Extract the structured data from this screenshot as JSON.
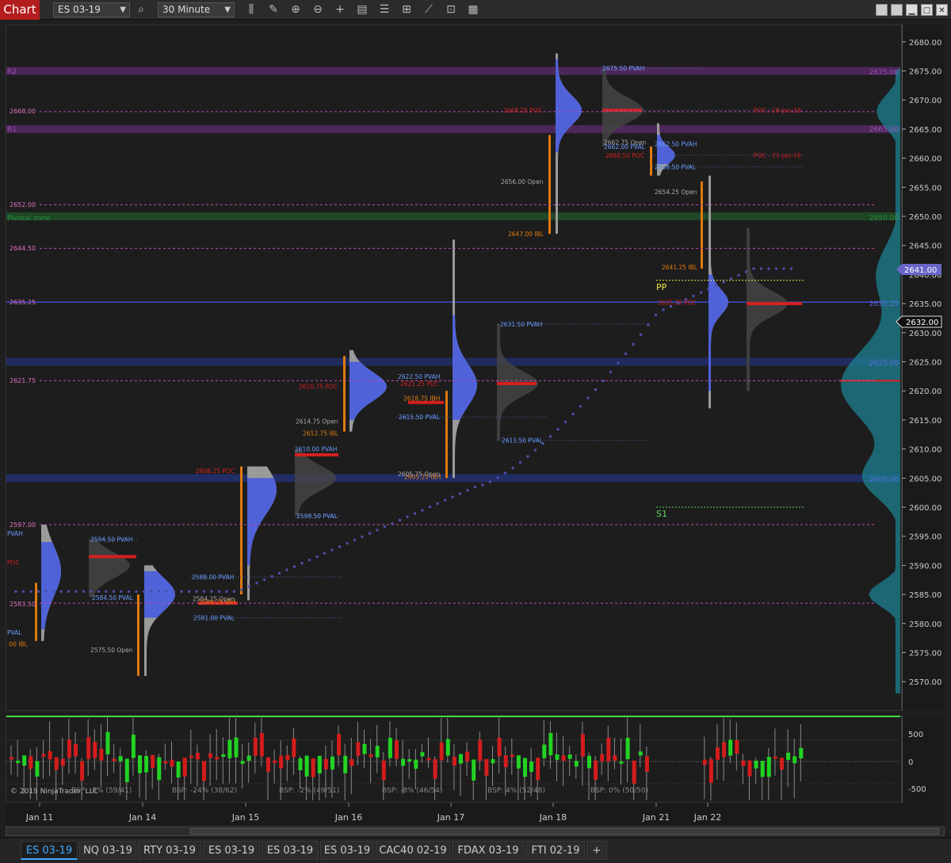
{
  "toolbar": {
    "title": "Chart",
    "instrument": "ES 03-19",
    "interval": "30 Minute",
    "icons": [
      "search-icon",
      "bar-type-icon",
      "draw-icon",
      "zoom-in-icon",
      "zoom-out-icon",
      "crosshair-icon",
      "data-box-icon",
      "properties-icon",
      "indicators-icon",
      "strategy-icon",
      "snapshot-icon",
      "templates-icon"
    ],
    "window_buttons": [
      "restore-icon",
      "maximize-icon",
      "minimize-icon",
      "close-icon"
    ]
  },
  "colors": {
    "background": "#1d1d1d",
    "profile_blue": "#4f62d8",
    "poc_red": "#d32020",
    "vah_blue": "#6a9bff",
    "ibl_orange": "#e07a10",
    "purple_band": "#5a2a6a",
    "green_band": "#1e5a2a",
    "blue_band": "#22306e"
  },
  "price_axis": {
    "ticks": [
      "2680.00",
      "2675.00",
      "2670.00",
      "2665.00",
      "2660.00",
      "2655.00",
      "2650.00",
      "2645.00",
      "2640.00",
      "2635.00",
      "2630.00",
      "2625.00",
      "2620.00",
      "2615.00",
      "2610.00",
      "2605.00",
      "2600.00",
      "2595.00",
      "2590.00",
      "2585.00",
      "2580.00",
      "2575.00",
      "2570.00"
    ],
    "current": {
      "label": "2641.00",
      "value": 2641.0
    },
    "last": {
      "label": "2632.00",
      "value": 2632.0
    }
  },
  "time_axis": [
    "Jan 11",
    "Jan 14",
    "Jan 15",
    "Jan 16",
    "Jan 17",
    "Jan 18",
    "Jan 21",
    "Jan 22"
  ],
  "indicator": {
    "ticks": [
      "500",
      "0",
      "-500"
    ],
    "bsp_labels": [
      "BSP: -8% (59/41)",
      "BSP: -24% (38/62)",
      "BSP: -2% (49/51)",
      "BSP: -8% (46/54)",
      "BSP: 4% (52/48)",
      "BSP: 0% (50/50)"
    ]
  },
  "copyright": "© 2019 NinjaTrader, LLC",
  "levels": {
    "r2": "R2",
    "r1": "R1",
    "s1": "S1",
    "pp": "PP",
    "pivotal": "Pivotal zone",
    "r2_right": "2675.00",
    "pz_right": "2650.00",
    "r1_right": "2665.00",
    "pp_right": "2635.25",
    "pl_right": "2625.00",
    "s1_right": "2605.00",
    "p2668": "2668.00",
    "p2652": "2652.00",
    "p2644": "2644.50",
    "p2635": "2635.25",
    "p2621": "2621.75",
    "p2597": "2597.00",
    "p2583": "2583.50"
  },
  "annotations": [
    {
      "text": "2675.50 PVAH",
      "color": "#6a9bff"
    },
    {
      "text": "2668.25 POC",
      "color": "#d32020"
    },
    {
      "text": "POC - 18-Jan-19",
      "color": "#d32020"
    },
    {
      "text": "2662.75 Open",
      "color": "#aaaaaa"
    },
    {
      "text": "2662.00 PVAL",
      "color": "#6a9bff"
    },
    {
      "text": "2662.50 PVAH",
      "color": "#6a9bff"
    },
    {
      "text": "2660.50 POC",
      "color": "#d32020"
    },
    {
      "text": "POC - 21-Jan-19",
      "color": "#d32020"
    },
    {
      "text": "2658.50 PVAL",
      "color": "#6a9bff"
    },
    {
      "text": "2656.00 Open",
      "color": "#aaaaaa"
    },
    {
      "text": "2654.25 Open",
      "color": "#aaaaaa"
    },
    {
      "text": "2647.00 IBL",
      "color": "#e07a10"
    },
    {
      "text": "2641.25 IBL",
      "color": "#e07a10"
    },
    {
      "text": "2635.25 POC",
      "color": "#d32020"
    },
    {
      "text": "2631.50 PVAH",
      "color": "#6a9bff"
    },
    {
      "text": "2622.50 PVAH",
      "color": "#6a9bff"
    },
    {
      "text": "2621.25 POC",
      "color": "#d32020"
    },
    {
      "text": "2620.75 POC",
      "color": "#d32020"
    },
    {
      "text": "2618.75 IBH",
      "color": "#e07a10"
    },
    {
      "text": "2615.50 PVAL",
      "color": "#6a9bff"
    },
    {
      "text": "2614.75 Open",
      "color": "#aaaaaa"
    },
    {
      "text": "2612.75 IBL",
      "color": "#e07a10"
    },
    {
      "text": "2611.50 PVAL",
      "color": "#6a9bff"
    },
    {
      "text": "2610.00 PVAH",
      "color": "#6a9bff"
    },
    {
      "text": "2606.25 POC",
      "color": "#d32020"
    },
    {
      "text": "2605.75 Open",
      "color": "#aaaaaa"
    },
    {
      "text": "2605.25 IBH",
      "color": "#e07a10"
    },
    {
      "text": "2598.50 PVAL",
      "color": "#6a9bff"
    },
    {
      "text": "2594.50 PVAH",
      "color": "#6a9bff"
    },
    {
      "text": "2588.00 PVAH",
      "color": "#6a9bff"
    },
    {
      "text": "2584.50 PVAL",
      "color": "#6a9bff"
    },
    {
      "text": "2584.25 Open",
      "color": "#aaaaaa"
    },
    {
      "text": "2584.25 IBH",
      "color": "#e07a10"
    },
    {
      "text": "2581.00 PVAL",
      "color": "#6a9bff"
    },
    {
      "text": "2575.50 Open",
      "color": "#aaaaaa"
    },
    {
      "text": "PVAH",
      "color": "#6a9bff"
    },
    {
      "text": "POC",
      "color": "#d32020"
    },
    {
      "text": "PVAL",
      "color": "#6a9bff"
    },
    {
      "text": ".00 IBL",
      "color": "#e07a10"
    }
  ],
  "tabs": [
    {
      "label": "ES 03-19",
      "active": true
    },
    {
      "label": "NQ 03-19",
      "active": false
    },
    {
      "label": "RTY 03-19",
      "active": false
    },
    {
      "label": "ES 03-19",
      "active": false
    },
    {
      "label": "ES 03-19",
      "active": false
    },
    {
      "label": "ES 03-19",
      "active": false
    },
    {
      "label": "CAC40 02-19",
      "active": false
    },
    {
      "label": "FDAX 03-19",
      "active": false
    },
    {
      "label": "FTI 02-19",
      "active": false
    }
  ],
  "add_tab": "+"
}
